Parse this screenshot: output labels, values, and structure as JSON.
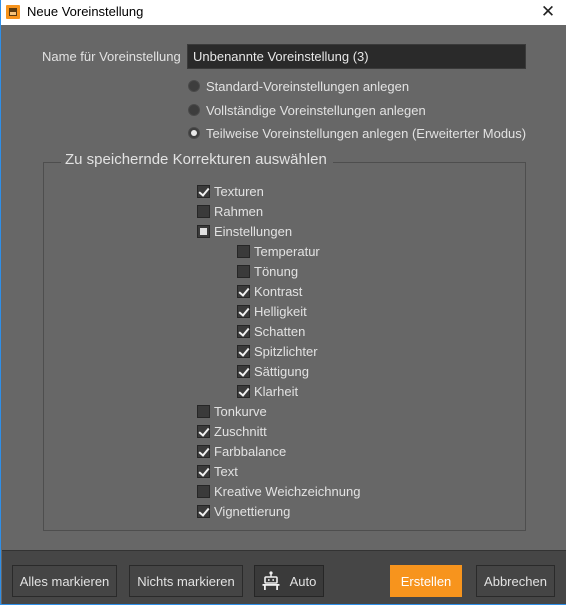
{
  "window": {
    "title": "Neue Voreinstellung",
    "app_icon": "image-app-icon",
    "close_glyph": "✕"
  },
  "form": {
    "name_label": "Name für Voreinstellung",
    "name_value": "Unbenannte Voreinstellung (3)",
    "radios": [
      {
        "label": "Standard-Voreinstellungen anlegen",
        "selected": false
      },
      {
        "label": "Vollständige Voreinstellungen anlegen",
        "selected": false
      },
      {
        "label": "Teilweise Voreinstellungen anlegen (Erweiterter Modus)",
        "selected": true
      }
    ]
  },
  "group": {
    "title": "Zu speichernde Korrekturen auswählen",
    "items": [
      {
        "label": "Texturen",
        "state": "checked",
        "level": 0
      },
      {
        "label": "Rahmen",
        "state": "unchecked",
        "level": 0
      },
      {
        "label": "Einstellungen",
        "state": "partial",
        "level": 0
      },
      {
        "label": "Temperatur",
        "state": "unchecked",
        "level": 1
      },
      {
        "label": "Tönung",
        "state": "unchecked",
        "level": 1
      },
      {
        "label": "Kontrast",
        "state": "checked",
        "level": 1
      },
      {
        "label": "Helligkeit",
        "state": "checked",
        "level": 1
      },
      {
        "label": "Schatten",
        "state": "checked",
        "level": 1
      },
      {
        "label": "Spitzlichter",
        "state": "checked",
        "level": 1
      },
      {
        "label": "Sättigung",
        "state": "checked",
        "level": 1
      },
      {
        "label": "Klarheit",
        "state": "checked",
        "level": 1
      },
      {
        "label": "Tonkurve",
        "state": "unchecked",
        "level": 0
      },
      {
        "label": "Zuschnitt",
        "state": "checked",
        "level": 0
      },
      {
        "label": "Farbbalance",
        "state": "checked",
        "level": 0
      },
      {
        "label": "Text",
        "state": "checked",
        "level": 0
      },
      {
        "label": "Kreative Weichzeichnung",
        "state": "unchecked",
        "level": 0
      },
      {
        "label": "Vignettierung",
        "state": "checked",
        "level": 0
      }
    ]
  },
  "footer": {
    "select_all": "Alles markieren",
    "select_none": "Nichts markieren",
    "auto": "Auto",
    "auto_icon": "robot-icon",
    "create": "Erstellen",
    "cancel": "Abbrechen"
  },
  "colors": {
    "accent": "#f7941d",
    "background": "#676767",
    "footer": "#464646",
    "input_bg": "#2a2a2a"
  }
}
